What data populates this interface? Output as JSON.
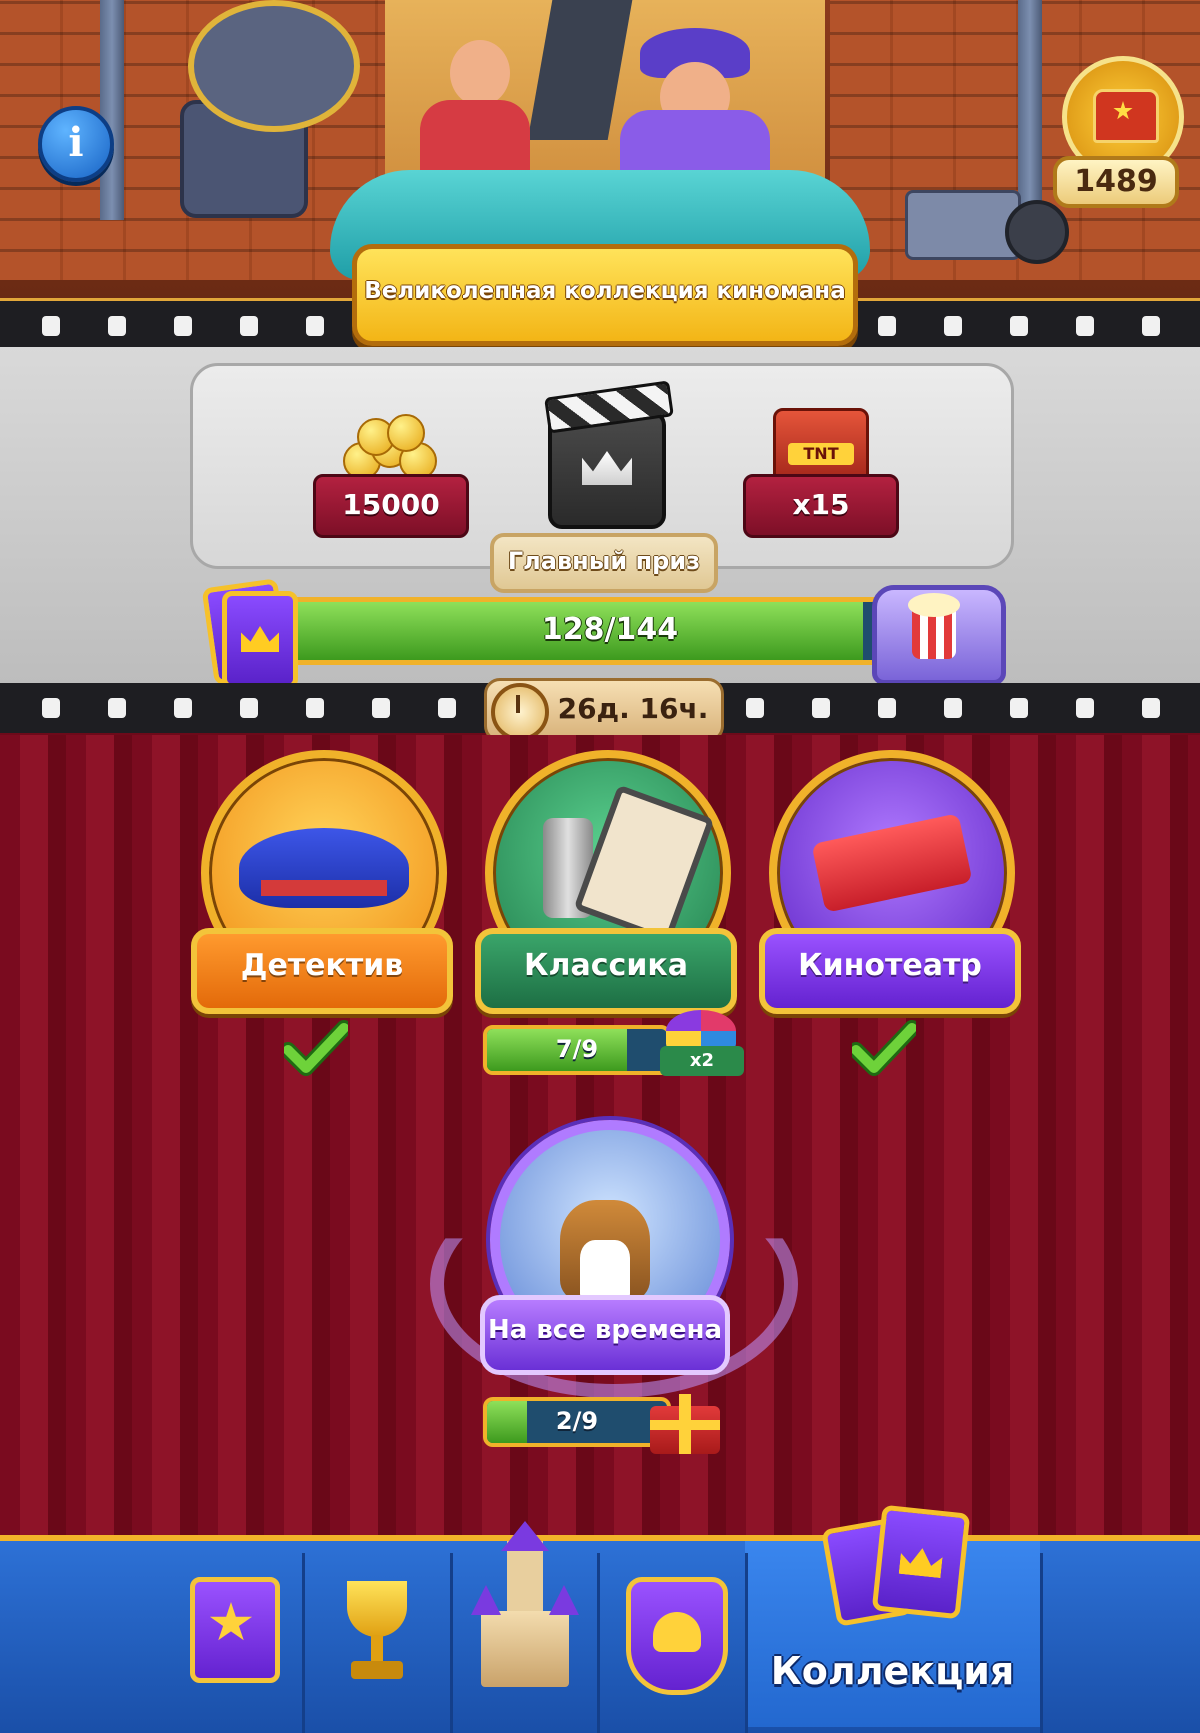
{
  "event": {
    "title": "Великолепная коллекция киномана",
    "chest_count": "1489",
    "timer": "26д. 16ч."
  },
  "grand_prize": {
    "label": "Главный приз",
    "rewards": [
      {
        "icon": "coins-icon",
        "amount": "15000"
      },
      {
        "icon": "clapperboard-icon",
        "amount": ""
      },
      {
        "icon": "tnt-booster-icon",
        "amount": "x15"
      }
    ],
    "progress_text": "128/144",
    "progress_fraction": 0.889
  },
  "categories": [
    {
      "name": "Детектив",
      "icon": "hat-icon",
      "completed": true,
      "color": "#f07a12"
    },
    {
      "name": "Классика",
      "icon": "film-reel-icon",
      "completed": false,
      "progress_text": "7/9",
      "progress_fraction": 0.778,
      "reward": "x2",
      "color": "#2c8a56"
    },
    {
      "name": "Кинотеатр",
      "icon": "ticket-icon",
      "completed": true,
      "color": "#7a2fd6"
    }
  ],
  "special_category": {
    "name": "На все времена",
    "progress_text": "2/9",
    "progress_fraction": 0.222
  },
  "nav": {
    "items": [
      {
        "icon": "star-book-icon"
      },
      {
        "icon": "trophy-icon"
      },
      {
        "icon": "castle-icon"
      },
      {
        "icon": "team-shield-icon"
      },
      {
        "icon": "cards-icon",
        "label": "Коллекция",
        "active": true
      }
    ]
  },
  "colors": {
    "accent_gold": "#f0b22a",
    "curtain": "#7a0b1f",
    "nav_blue": "#2d71d6"
  }
}
